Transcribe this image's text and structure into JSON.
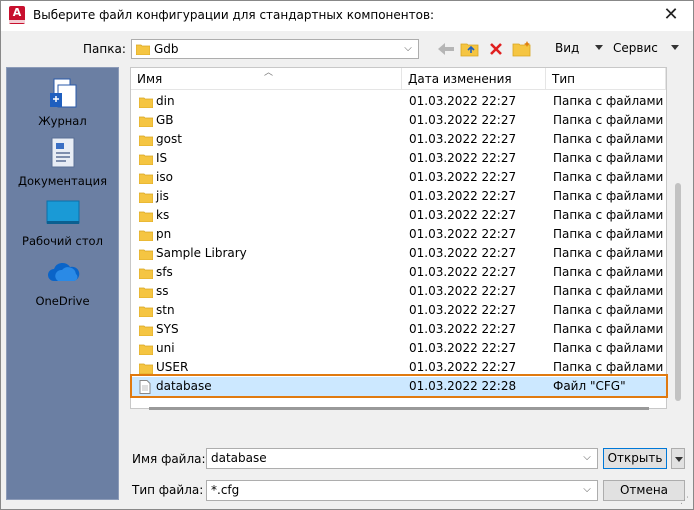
{
  "window": {
    "title": "Выберите файл конфигурации для стандартных компонентов:",
    "app_icon_letter": "A"
  },
  "toolbar": {
    "folder_label": "Папка:",
    "current_folder": "Gdb",
    "view_label": "Вид",
    "tools_label": "Сервис",
    "icons": [
      "back-arrow-icon",
      "up-folder-icon",
      "delete-icon",
      "new-folder-icon"
    ]
  },
  "places": [
    {
      "label": "Журнал",
      "icon": "history-icon"
    },
    {
      "label": "Документация",
      "icon": "documents-icon"
    },
    {
      "label": "Рабочий стол",
      "icon": "desktop-icon"
    },
    {
      "label": "OneDrive",
      "icon": "onedrive-icon"
    }
  ],
  "list": {
    "columns": [
      "Имя",
      "Дата изменения",
      "Тип"
    ],
    "rows": [
      {
        "name": "din",
        "date": "01.03.2022 22:27",
        "type": "Папка с файлами",
        "kind": "folder"
      },
      {
        "name": "GB",
        "date": "01.03.2022 22:27",
        "type": "Папка с файлами",
        "kind": "folder"
      },
      {
        "name": "gost",
        "date": "01.03.2022 22:27",
        "type": "Папка с файлами",
        "kind": "folder"
      },
      {
        "name": "IS",
        "date": "01.03.2022 22:27",
        "type": "Папка с файлами",
        "kind": "folder"
      },
      {
        "name": "iso",
        "date": "01.03.2022 22:27",
        "type": "Папка с файлами",
        "kind": "folder"
      },
      {
        "name": "jis",
        "date": "01.03.2022 22:27",
        "type": "Папка с файлами",
        "kind": "folder"
      },
      {
        "name": "ks",
        "date": "01.03.2022 22:27",
        "type": "Папка с файлами",
        "kind": "folder"
      },
      {
        "name": "pn",
        "date": "01.03.2022 22:27",
        "type": "Папка с файлами",
        "kind": "folder"
      },
      {
        "name": "Sample Library",
        "date": "01.03.2022 22:27",
        "type": "Папка с файлами",
        "kind": "folder"
      },
      {
        "name": "sfs",
        "date": "01.03.2022 22:27",
        "type": "Папка с файлами",
        "kind": "folder"
      },
      {
        "name": "ss",
        "date": "01.03.2022 22:27",
        "type": "Папка с файлами",
        "kind": "folder"
      },
      {
        "name": "stn",
        "date": "01.03.2022 22:27",
        "type": "Папка с файлами",
        "kind": "folder"
      },
      {
        "name": "SYS",
        "date": "01.03.2022 22:27",
        "type": "Папка с файлами",
        "kind": "folder"
      },
      {
        "name": "uni",
        "date": "01.03.2022 22:27",
        "type": "Папка с файлами",
        "kind": "folder"
      },
      {
        "name": "USER",
        "date": "01.03.2022 22:27",
        "type": "Папка с файлами",
        "kind": "folder"
      },
      {
        "name": "database",
        "date": "01.03.2022 22:28",
        "type": "Файл \"CFG\"",
        "kind": "file",
        "selected": true
      }
    ]
  },
  "bottom": {
    "filename_label": "Имя файла:",
    "filename_value": "database",
    "filetype_label": "Тип файла:",
    "filetype_value": "*.cfg",
    "open_label": "Открыть",
    "cancel_label": "Отмена"
  },
  "colors": {
    "selection": "#cce8ff",
    "highlight": "#e07a10",
    "folder": "#f5c542",
    "places_bg": "#6b7fa3"
  }
}
